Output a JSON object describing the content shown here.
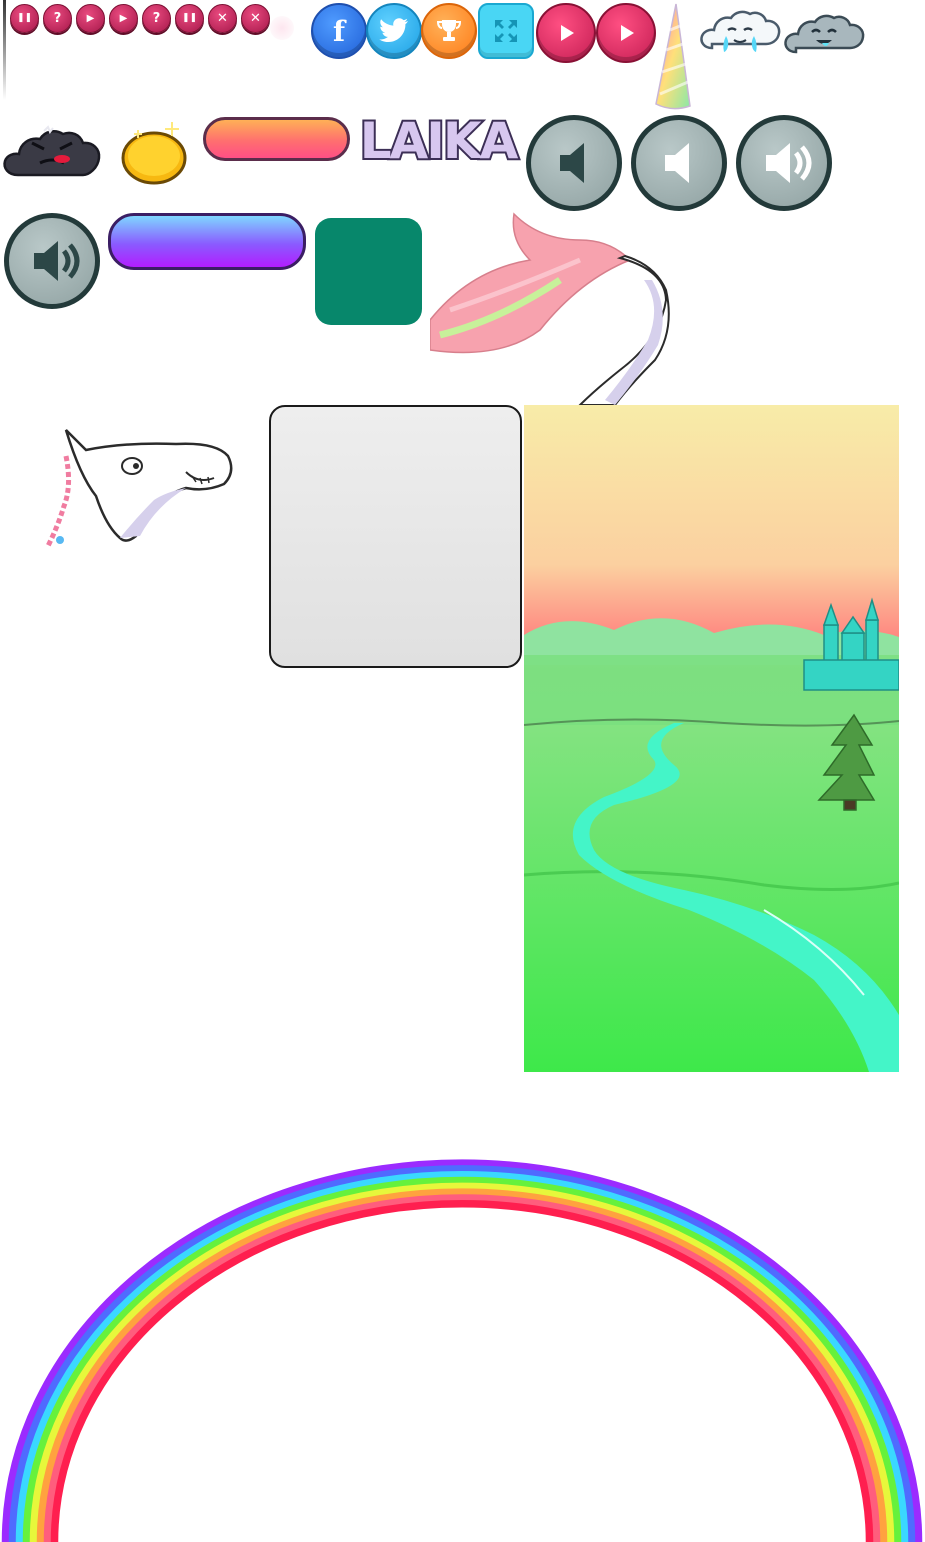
{
  "title_logo": "LAIKA",
  "icons": {
    "small_buttons": [
      "pause-icon",
      "help-icon",
      "play-icon",
      "play-icon",
      "help-icon",
      "pause-icon",
      "close-icon",
      "close-icon"
    ],
    "social": [
      "facebook-icon",
      "twitter-icon",
      "trophy-icon",
      "fullscreen-icon"
    ],
    "sound_levels": [
      "sound-level-1-icon",
      "sound-level-2-icon",
      "sound-level-3-icon",
      "sound-level-4-icon"
    ]
  },
  "glyphs": {
    "pause": "❚❚",
    "help": "?",
    "play": "▶",
    "close": "✕",
    "facebook": "f",
    "twitter": "🐦",
    "trophy": "🏆"
  },
  "colors": {
    "accent_pink": "#c31d52",
    "facebook_blue": "#1f5fd6",
    "twitter_blue": "#1b9fe3",
    "trophy_orange": "#ff7a16",
    "teal_tile": "#07876b",
    "background_sky": "#f8eca8",
    "background_grass": "#4ee64e",
    "river": "#44f5c8"
  },
  "rainbow_colors": [
    "#9b2bff",
    "#4f6bff",
    "#3ad8ff",
    "#66f13c",
    "#e7f73b",
    "#ffa23f",
    "#ff5d7d",
    "#ff1f4f"
  ]
}
